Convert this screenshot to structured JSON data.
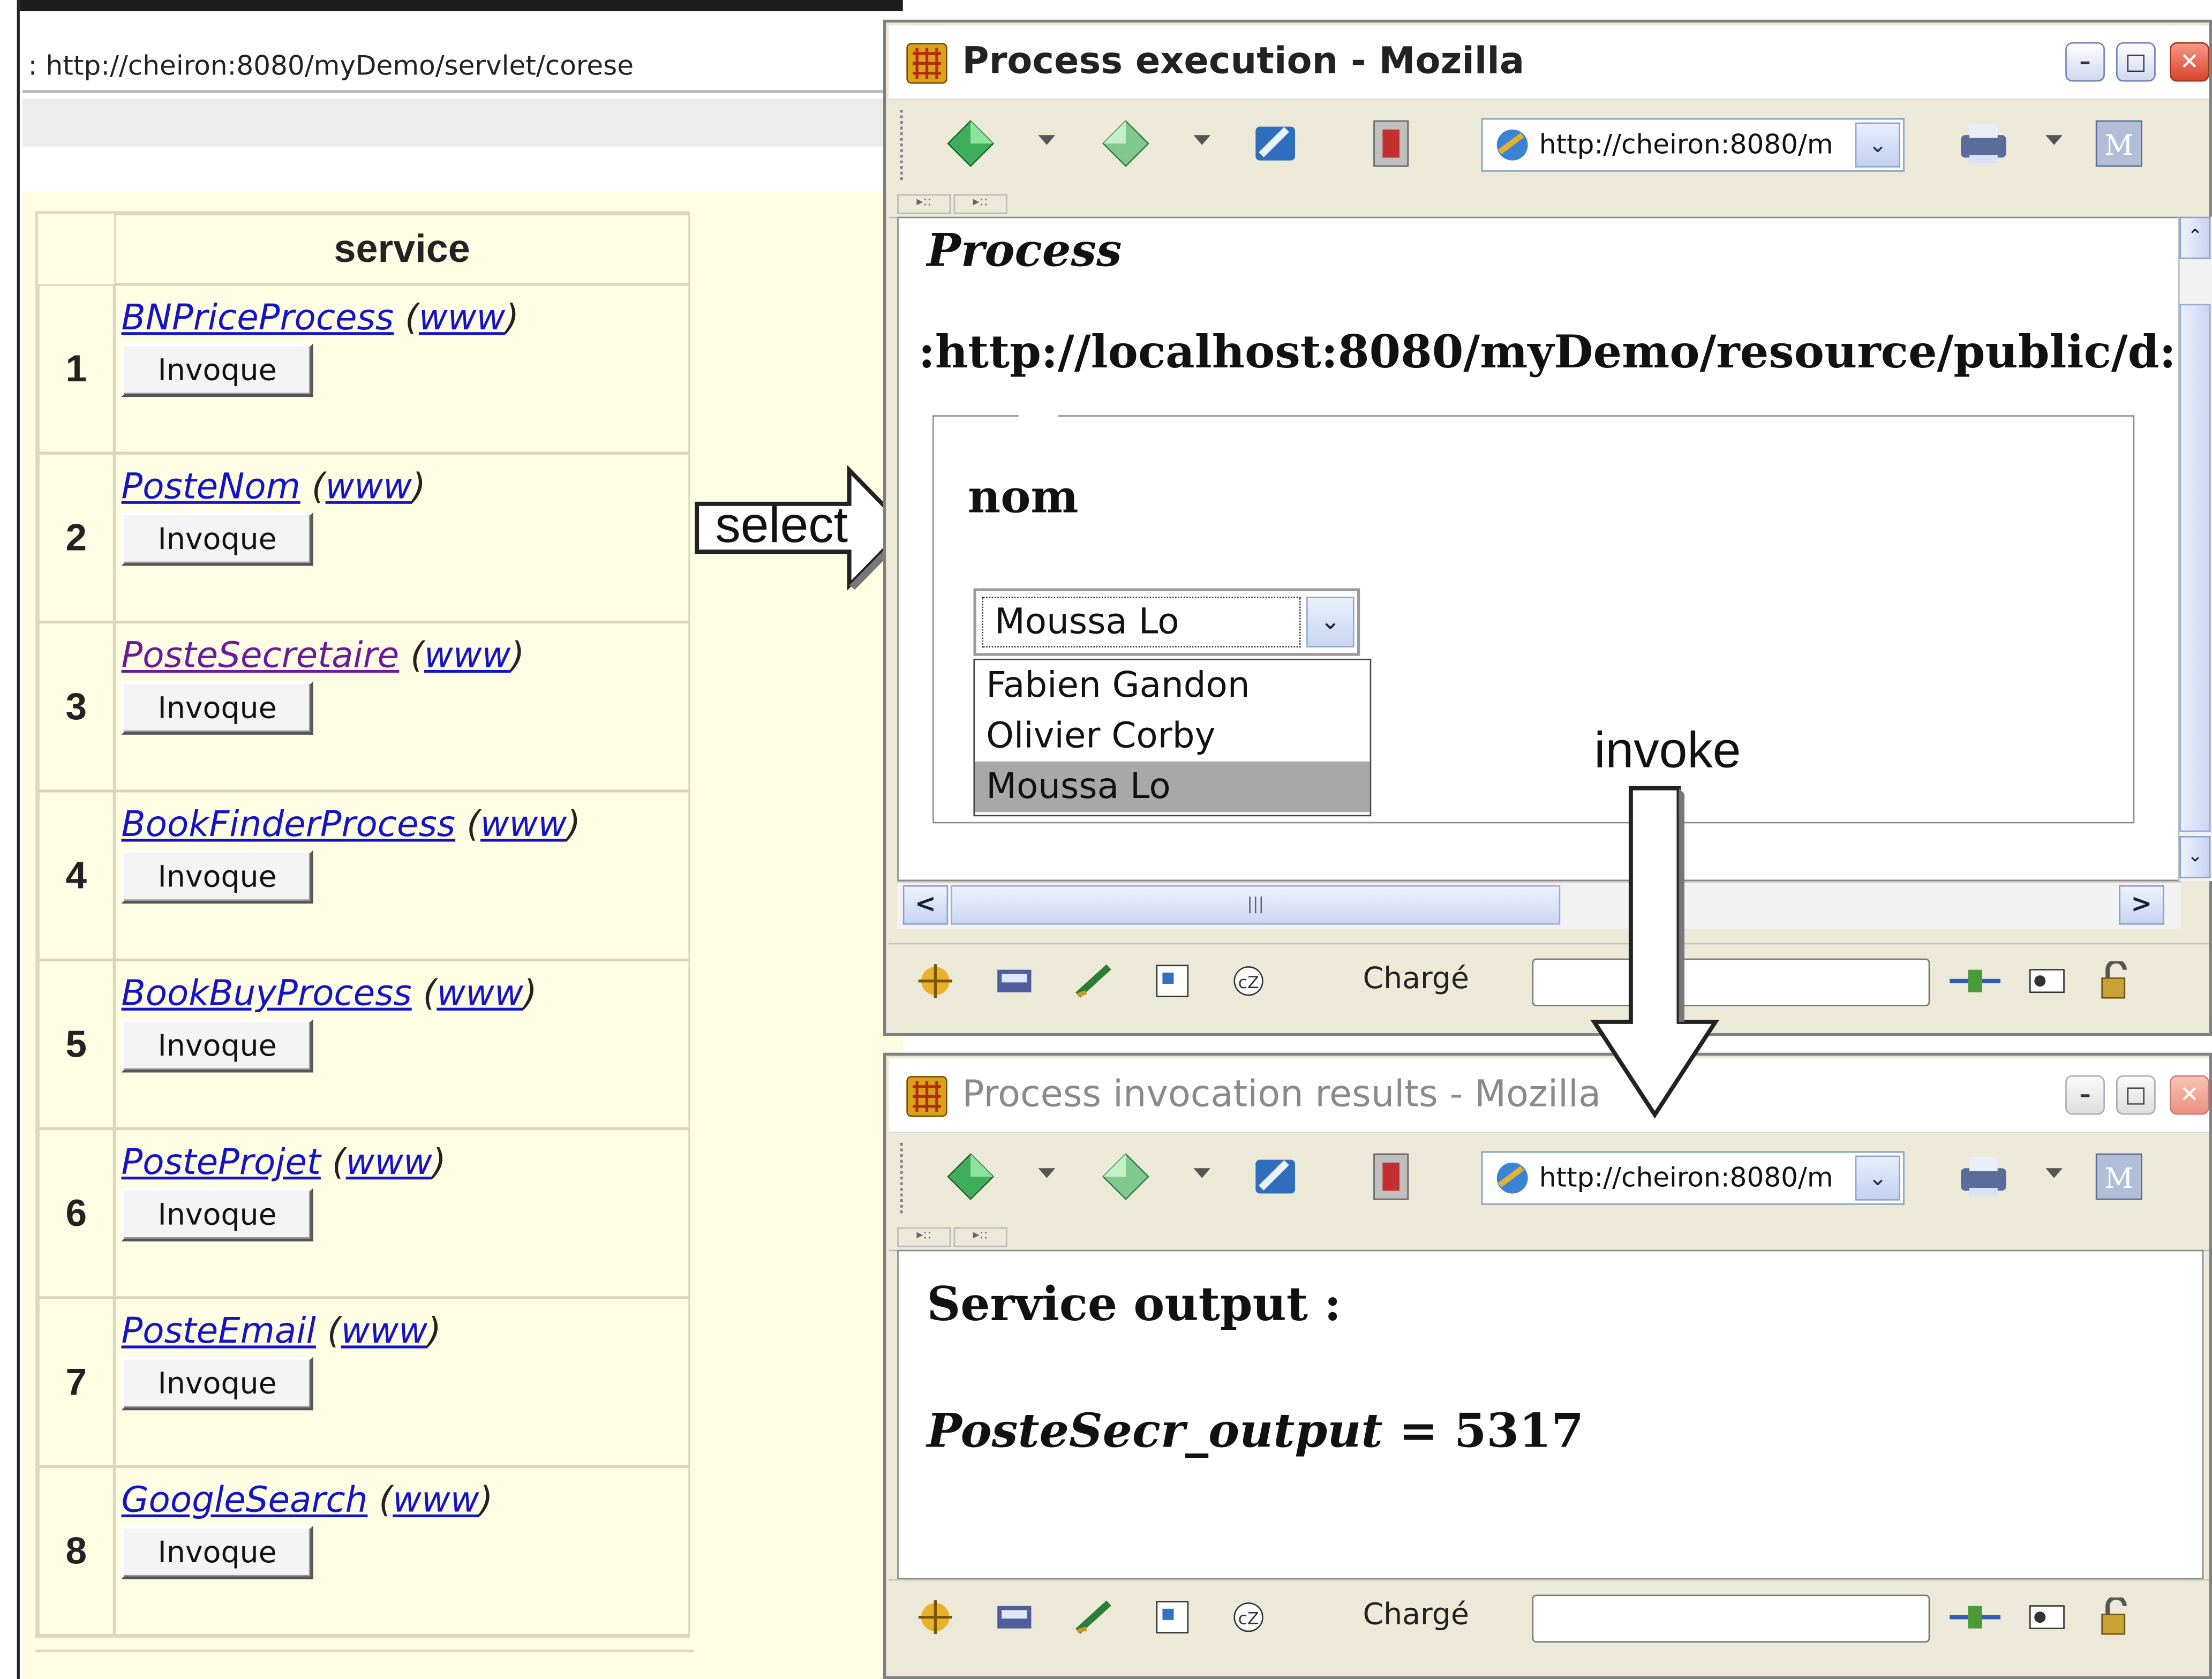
{
  "left_browser": {
    "url": "http://cheiron:8080/myDemo/servlet/corese",
    "url_prefix": ":"
  },
  "services_table": {
    "header": "service",
    "button_label": "Invoque",
    "www_label": "www",
    "rows": [
      {
        "num": "1",
        "name": "BNPriceProcess",
        "visited": false
      },
      {
        "num": "2",
        "name": "PosteNom",
        "visited": false
      },
      {
        "num": "3",
        "name": "PosteSecretaire",
        "visited": true
      },
      {
        "num": "4",
        "name": "BookFinderProcess",
        "visited": false
      },
      {
        "num": "5",
        "name": "BookBuyProcess",
        "visited": false
      },
      {
        "num": "6",
        "name": "PosteProjet",
        "visited": false
      },
      {
        "num": "7",
        "name": "PosteEmail",
        "visited": false
      },
      {
        "num": "8",
        "name": "GoogleSearch",
        "visited": false
      }
    ]
  },
  "annotations": {
    "select_label": "select",
    "invoke_label": "invoke"
  },
  "window_execution": {
    "title": "Process execution - Mozilla",
    "url": "http://cheiron:8080/m",
    "heading": "Process",
    "process_url": ":http://localhost:8080/myDemo/resource/public/d:",
    "param_label": "nom",
    "select_value": "Moussa Lo",
    "options": [
      "Fabien Gandon",
      "Olivier Corby",
      "Moussa Lo"
    ],
    "selected_option_index": 2,
    "status": "Chargé"
  },
  "window_results": {
    "title": "Process invocation results - Mozilla",
    "url": "http://cheiron:8080/m",
    "heading": "Service output :",
    "output_name": "PosteSecr_output",
    "output_rest": " = 5317",
    "status": "Chargé"
  },
  "colors": {
    "table_bg": "#fffde4",
    "link": "#1313c8",
    "visited_link": "#6a1a9a",
    "selected_option": "#a8a8a8",
    "window_chrome": "#ece9d8"
  }
}
